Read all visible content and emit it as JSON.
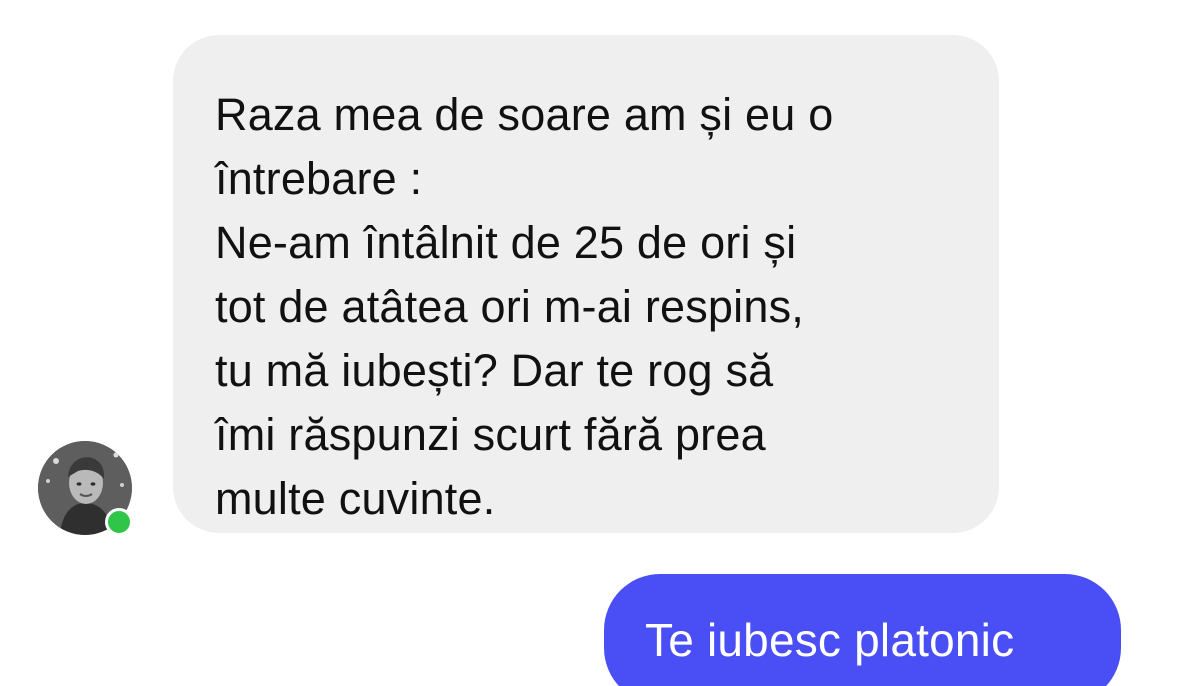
{
  "conversation": {
    "incoming_message": "Raza mea de soare am și eu o\nîntrebare :\nNe-am întâlnit de 25 de ori și\ntot de atâtea ori m-ai respins,\ntu mă iubești? Dar te rog să\nîmi răspunzi scurt fără prea\nmulte cuvinte.",
    "outgoing_message": "Te iubesc platonic"
  },
  "sender": {
    "online": true,
    "status_color": "#2fc549"
  },
  "colors": {
    "incoming_bubble": "#efefef",
    "outgoing_bubble": "#4a4ff5",
    "background": "#ffffff"
  },
  "icons": {
    "avatar": "profile-photo",
    "status": "online-dot"
  }
}
